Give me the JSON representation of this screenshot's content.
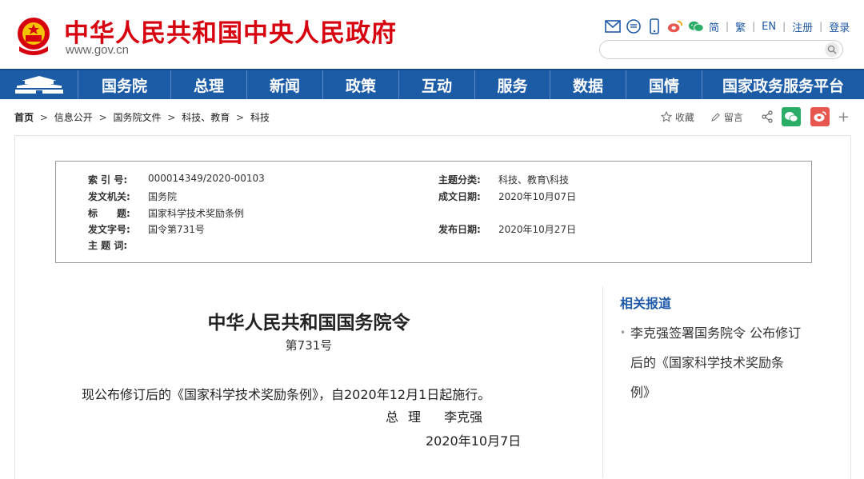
{
  "header": {
    "site_title": "中华人民共和国中央人民政府",
    "site_domain": "www.gov.cn",
    "search_placeholder": "",
    "toolbar_links": [
      "简",
      "繁",
      "EN",
      "注册",
      "登录"
    ],
    "toolbar_icons": [
      "mail-icon",
      "message-icon",
      "mobile-icon",
      "weibo-icon",
      "wechat-icon"
    ]
  },
  "nav": {
    "items": [
      "国务院",
      "总理",
      "新闻",
      "政策",
      "互动",
      "服务",
      "数据",
      "国情",
      "国家政务服务平台"
    ]
  },
  "breadcrumb": {
    "home": "首页",
    "items": [
      "信息公开",
      "国务院文件",
      "科技、教育",
      "科技"
    ]
  },
  "actions": {
    "favorite": "收藏",
    "comment": "留言",
    "plus": "+"
  },
  "meta": {
    "index_label": "索 引 号:",
    "index_value": "000014349/2020-00103",
    "topic_label": "主题分类:",
    "topic_value": "科技、教育\\科技",
    "issuer_label": "发文机关:",
    "issuer_value": "国务院",
    "created_label": "成文日期:",
    "created_value": "2020年10月07日",
    "title_label": "标　　题:",
    "title_value": "国家科学技术奖励条例",
    "docno_label": "发文字号:",
    "docno_value": "国令第731号",
    "published_label": "发布日期:",
    "published_value": "2020年10月27日",
    "keywords_label": "主 题 词:",
    "keywords_value": ""
  },
  "document": {
    "title": "中华人民共和国国务院令",
    "number": "第731号",
    "body": "现公布修订后的《国家科学技术奖励条例》，自2020年12月1日起施行。",
    "signer_role": "总理",
    "signer_name": "李克强",
    "date": "2020年10月7日"
  },
  "related": {
    "title": "相关报道",
    "items": [
      "李克强签署国务院令 公布修订",
      "后的《国家科学技术奖励条",
      "例》"
    ]
  },
  "colors": {
    "brand_red": "#d7000f",
    "nav_blue": "#1c5ca7",
    "link_blue": "#1f5aa8",
    "wechat_green": "#2aae67",
    "weibo_red": "#e8574f"
  }
}
